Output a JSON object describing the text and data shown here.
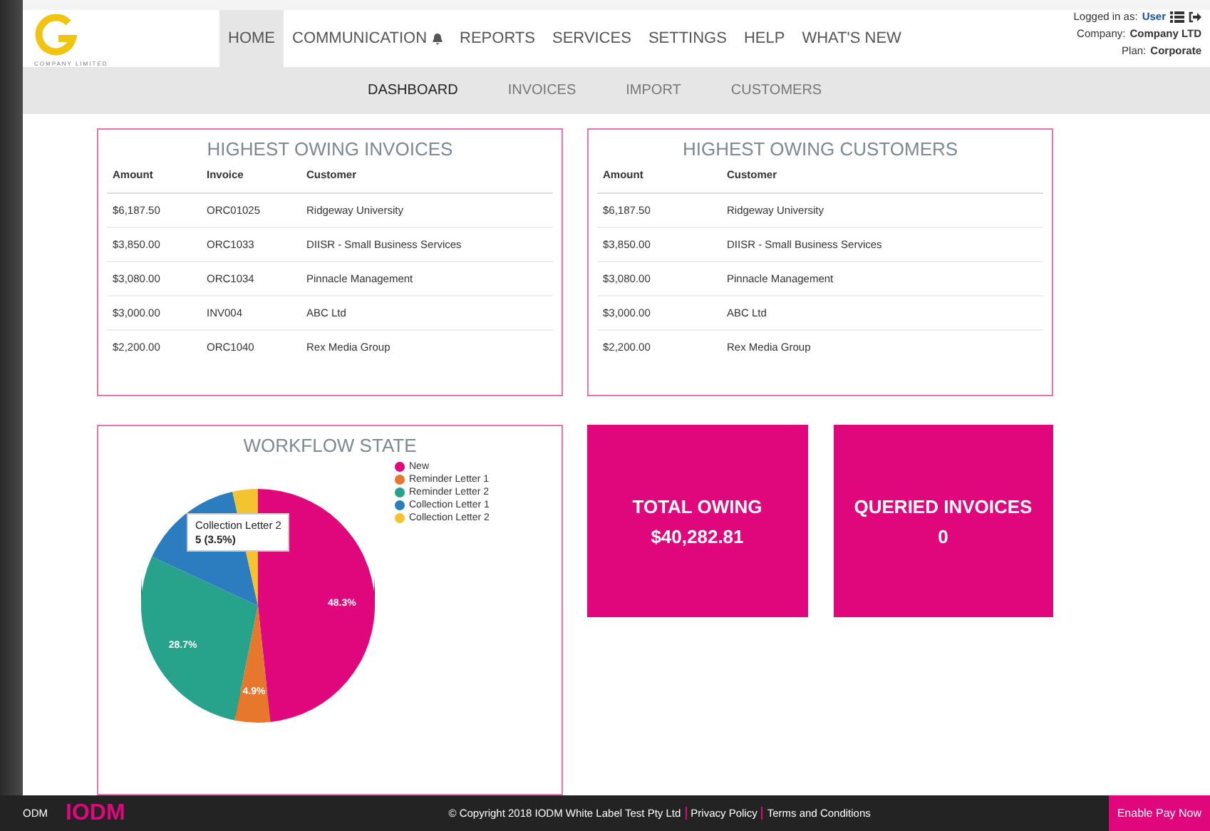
{
  "logo": {
    "caption": "COMPANY LIMITED"
  },
  "nav": [
    {
      "label": "HOME",
      "selected": true,
      "bell": false
    },
    {
      "label": "COMMUNICATION",
      "selected": false,
      "bell": true
    },
    {
      "label": "REPORTS",
      "selected": false,
      "bell": false
    },
    {
      "label": "SERVICES",
      "selected": false,
      "bell": false
    },
    {
      "label": "SETTINGS",
      "selected": false,
      "bell": false
    },
    {
      "label": "HELP",
      "selected": false,
      "bell": false
    },
    {
      "label": "WHAT'S NEW",
      "selected": false,
      "bell": false
    }
  ],
  "account": {
    "logged_in_label": "Logged in as:",
    "user": "User",
    "company_label": "Company:",
    "company": "Company LTD",
    "plan_label": "Plan:",
    "plan": "Corporate"
  },
  "subnav": [
    {
      "label": "DASHBOARD",
      "selected": true
    },
    {
      "label": "INVOICES",
      "selected": false
    },
    {
      "label": "IMPORT",
      "selected": false
    },
    {
      "label": "CUSTOMERS",
      "selected": false
    }
  ],
  "invoices": {
    "title": "HIGHEST OWING INVOICES",
    "columns": [
      "Amount",
      "Invoice",
      "Customer"
    ],
    "rows": [
      [
        "$6,187.50",
        "ORC01025",
        "Ridgeway University"
      ],
      [
        "$3,850.00",
        "ORC1033",
        "DIISR - Small Business Services"
      ],
      [
        "$3,080.00",
        "ORC1034",
        "Pinnacle Management"
      ],
      [
        "$3,000.00",
        "INV004",
        "ABC Ltd"
      ],
      [
        "$2,200.00",
        "ORC1040",
        "Rex Media Group"
      ]
    ]
  },
  "customers": {
    "title": "HIGHEST OWING CUSTOMERS",
    "columns": [
      "Amount",
      "Customer"
    ],
    "rows": [
      [
        "$6,187.50",
        "Ridgeway University"
      ],
      [
        "$3,850.00",
        "DIISR - Small Business Services"
      ],
      [
        "$3,080.00",
        "Pinnacle Management"
      ],
      [
        "$3,000.00",
        "ABC Ltd"
      ],
      [
        "$2,200.00",
        "Rex Media Group"
      ]
    ]
  },
  "workflow": {
    "title": "WORKFLOW STATE",
    "chart_data": {
      "type": "pie",
      "categories": [
        "New",
        "Reminder Letter 1",
        "Reminder Letter 2",
        "Collection Letter 1",
        "Collection Letter 2"
      ],
      "series": [
        {
          "values": [
            48.3,
            4.9,
            28.7,
            14.6,
            3.5
          ],
          "colors": [
            "#e0077d",
            "#e8772e",
            "#26a38a",
            "#2b7dc0",
            "#f4c430"
          ]
        }
      ],
      "legend": "right",
      "value_labels": [
        "48.3%",
        "4.9%",
        "28.7%",
        null,
        null
      ]
    },
    "tooltip": {
      "title": "Collection Letter 2",
      "value": "5 (3.5%)"
    }
  },
  "tiles": [
    {
      "label": "TOTAL OWING",
      "value": "$40,282.81"
    },
    {
      "label": "QUERIED INVOICES",
      "value": "0"
    }
  ],
  "footer": {
    "cut_brand": "ODM",
    "brand": "IODM",
    "copyright": "© Copyright 2018 IODM White Label Test Pty Ltd",
    "links": [
      "Privacy Policy",
      "Terms and Conditions"
    ],
    "button": "Enable Pay Now"
  }
}
